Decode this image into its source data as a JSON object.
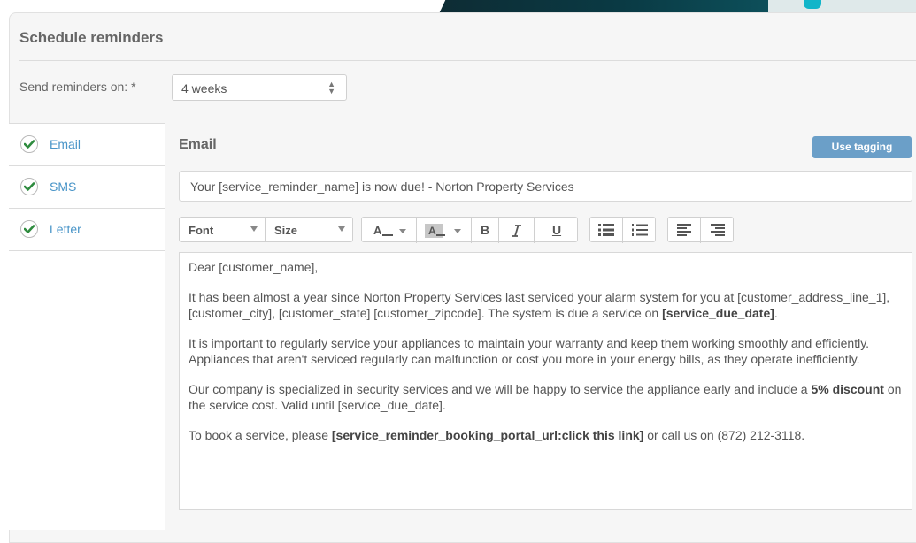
{
  "schedule": {
    "title": "Schedule reminders",
    "send_label": "Send reminders on: *",
    "send_value": "4 weeks"
  },
  "sidebar": {
    "items": [
      {
        "label": "Email",
        "checked": true
      },
      {
        "label": "SMS",
        "checked": true
      },
      {
        "label": "Letter",
        "checked": true
      }
    ]
  },
  "editor": {
    "heading": "Email",
    "tagging_button": "Use tagging",
    "subject": "Your [service_reminder_name] is now due! - Norton Property Services",
    "toolbar": {
      "font": "Font",
      "size": "Size",
      "bold": "B",
      "italic": "I",
      "underline": "U"
    },
    "body": {
      "greeting": "Dear [customer_name],",
      "p1_text": "It has been almost a year since Norton Property Services last serviced your alarm system for you at [customer_address_line_1], [customer_city], [customer_state] [customer_zipcode]. The system is due a service on ",
      "p1_bold": "[service_due_date]",
      "p1_end": ".",
      "p2": "It is important to regularly service your appliances to maintain your warranty and keep them working smoothly and efficiently. Appliances that aren't serviced regularly can malfunction or cost you more in your energy bills, as they operate inefficiently.",
      "p3_text": "Our company is specialized in security services and we will be happy to service the appliance early and include a ",
      "p3_bold": "5% discount",
      "p3_end": " on the service cost. Valid until [service_due_date].",
      "p4_text": "To book a service, please ",
      "p4_bold": "[service_reminder_booking_portal_url:click this link]",
      "p4_end": " or call us on (872) 212-3118."
    }
  },
  "colors": {
    "accent": "#6b9fc8",
    "link": "#4a95c8",
    "check": "#2e8b3e"
  }
}
